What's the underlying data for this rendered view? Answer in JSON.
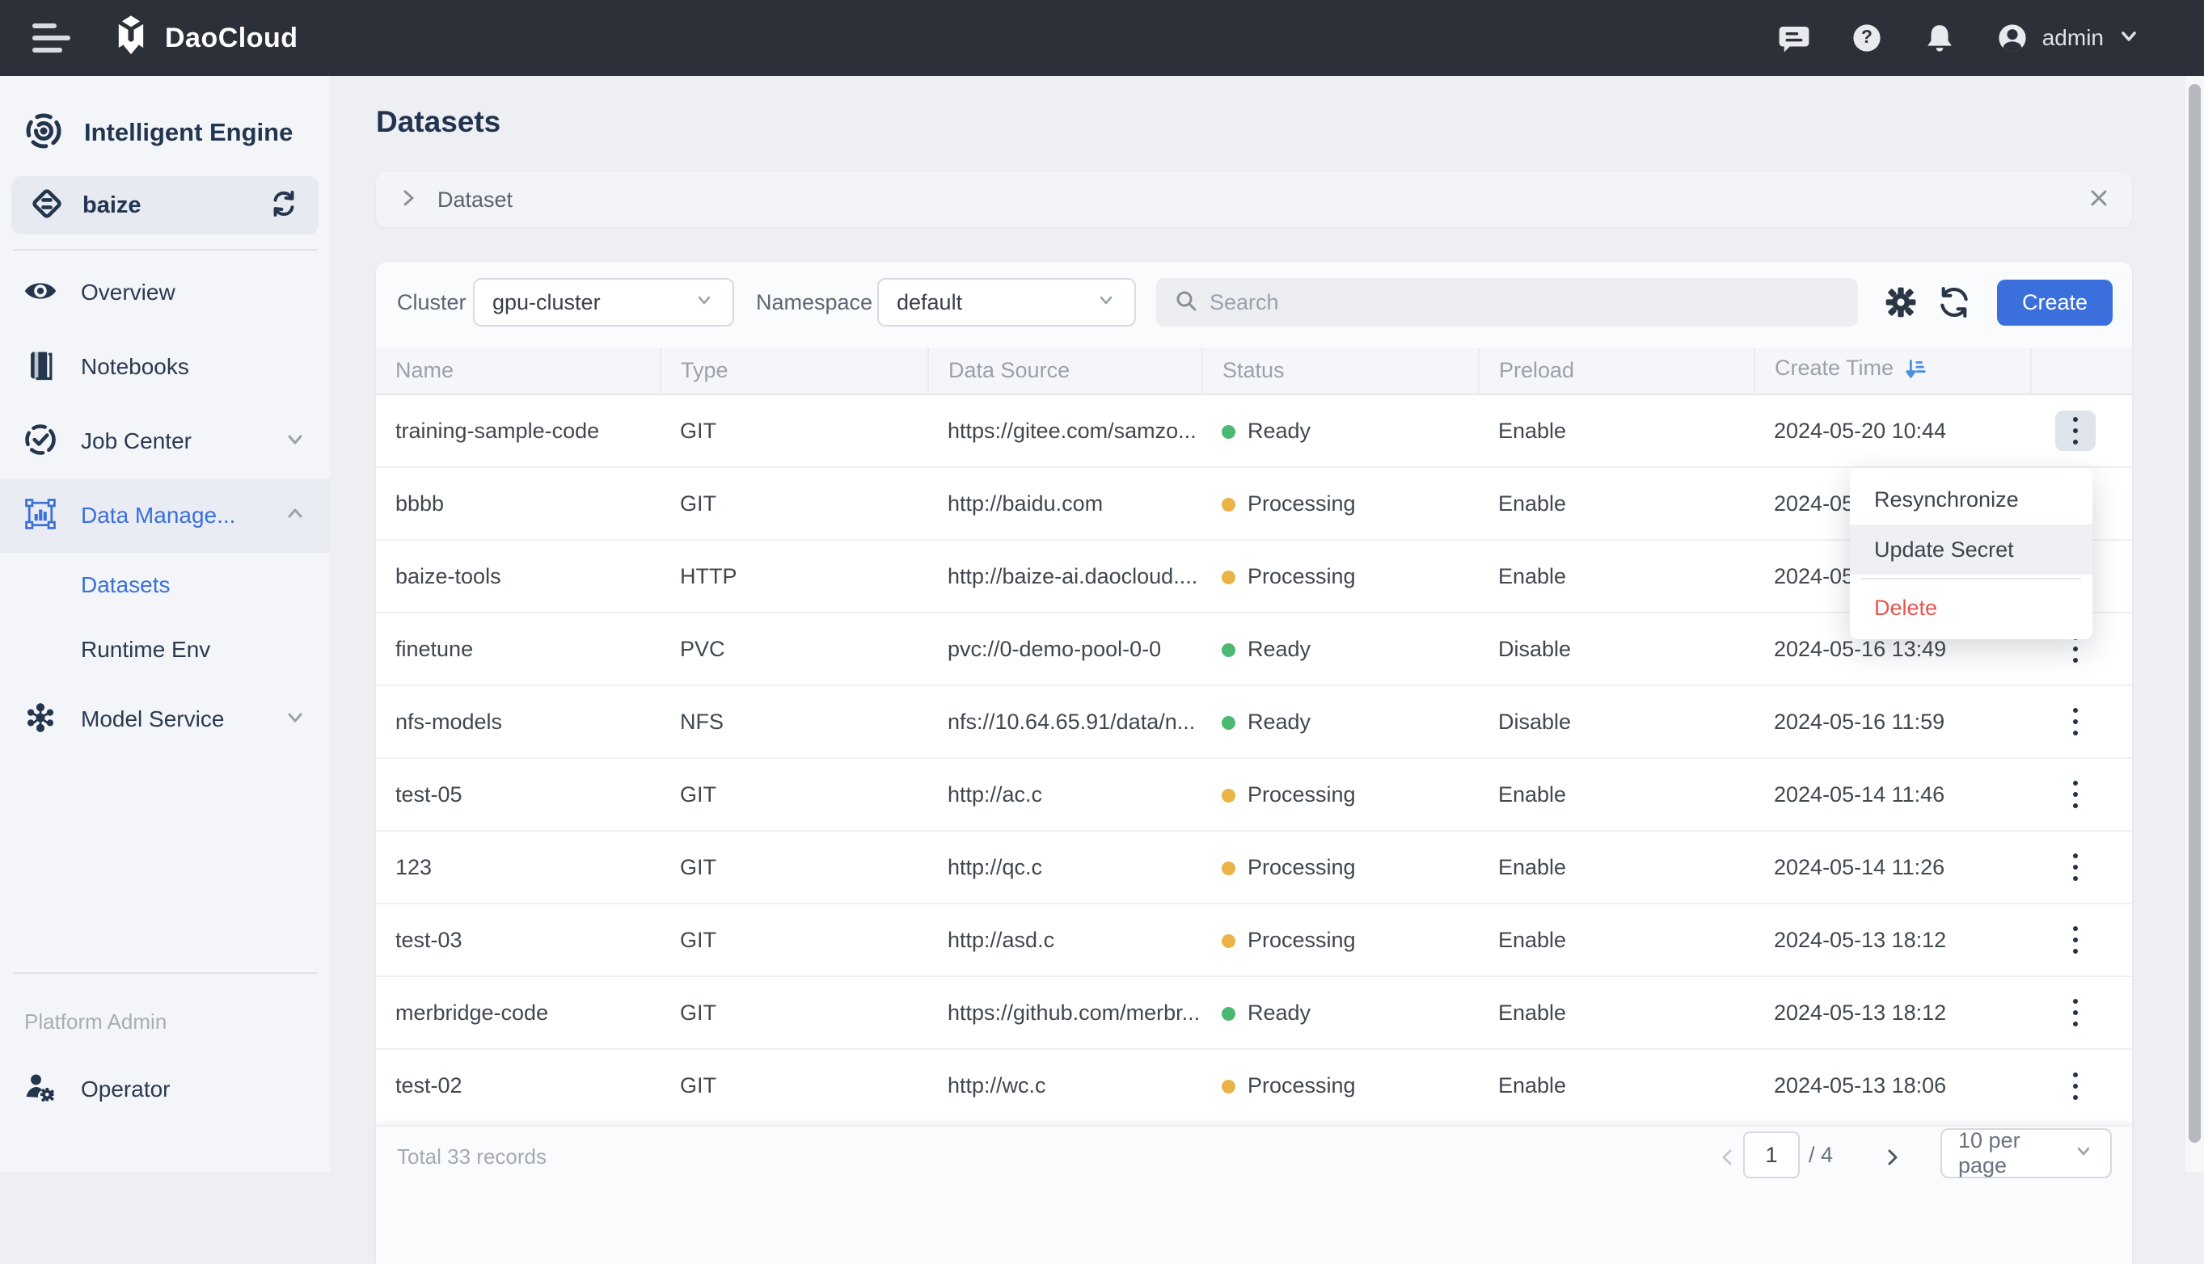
{
  "topbar": {
    "brand": "DaoCloud",
    "user": "admin"
  },
  "sidebar": {
    "product_label": "Intelligent Engine",
    "workspace_label": "baize",
    "items": [
      {
        "label": "Overview"
      },
      {
        "label": "Notebooks"
      },
      {
        "label": "Job Center"
      },
      {
        "label": "Data Manage..."
      },
      {
        "label": "Model Service"
      }
    ],
    "sub_items": [
      {
        "label": "Datasets"
      },
      {
        "label": "Runtime Env"
      }
    ],
    "section_label": "Platform Admin",
    "bottom_items": [
      {
        "label": "Operator"
      }
    ]
  },
  "page": {
    "title": "Datasets"
  },
  "expander": {
    "label": "Dataset"
  },
  "filters": {
    "cluster_label": "Cluster",
    "cluster_value": "gpu-cluster",
    "namespace_label": "Namespace",
    "namespace_value": "default",
    "search_placeholder": "Search",
    "create_label": "Create"
  },
  "table": {
    "columns": [
      "Name",
      "Type",
      "Data Source",
      "Status",
      "Preload",
      "Create Time"
    ],
    "rows": [
      {
        "name": "training-sample-code",
        "type": "GIT",
        "source": "https://gitee.com/samzo...",
        "status": "Ready",
        "status_color": "#4cb973",
        "preload": "Enable",
        "created": "2024-05-20 10:44"
      },
      {
        "name": "bbbb",
        "type": "GIT",
        "source": "http://baidu.com",
        "status": "Processing",
        "status_color": "#e9b445",
        "preload": "Enable",
        "created": "2024-05"
      },
      {
        "name": "baize-tools",
        "type": "HTTP",
        "source": "http://baize-ai.daocloud....",
        "status": "Processing",
        "status_color": "#e9b445",
        "preload": "Enable",
        "created": "2024-05"
      },
      {
        "name": "finetune",
        "type": "PVC",
        "source": "pvc://0-demo-pool-0-0",
        "status": "Ready",
        "status_color": "#4cb973",
        "preload": "Disable",
        "created": "2024-05-16 13:49"
      },
      {
        "name": "nfs-models",
        "type": "NFS",
        "source": "nfs://10.64.65.91/data/n...",
        "status": "Ready",
        "status_color": "#4cb973",
        "preload": "Disable",
        "created": "2024-05-16 11:59"
      },
      {
        "name": "test-05",
        "type": "GIT",
        "source": "http://ac.c",
        "status": "Processing",
        "status_color": "#e9b445",
        "preload": "Enable",
        "created": "2024-05-14 11:46"
      },
      {
        "name": "123",
        "type": "GIT",
        "source": "http://qc.c",
        "status": "Processing",
        "status_color": "#e9b445",
        "preload": "Enable",
        "created": "2024-05-14 11:26"
      },
      {
        "name": "test-03",
        "type": "GIT",
        "source": "http://asd.c",
        "status": "Processing",
        "status_color": "#e9b445",
        "preload": "Enable",
        "created": "2024-05-13 18:12"
      },
      {
        "name": "merbridge-code",
        "type": "GIT",
        "source": "https://github.com/merbr...",
        "status": "Ready",
        "status_color": "#4cb973",
        "preload": "Enable",
        "created": "2024-05-13 18:12"
      },
      {
        "name": "test-02",
        "type": "GIT",
        "source": "http://wc.c",
        "status": "Processing",
        "status_color": "#e9b445",
        "preload": "Enable",
        "created": "2024-05-13 18:06"
      }
    ]
  },
  "context_menu": {
    "items": [
      {
        "label": "Resynchronize"
      },
      {
        "label": "Update Secret"
      },
      {
        "label": "Delete"
      }
    ]
  },
  "pagination": {
    "total_text": "Total 33 records",
    "page": "1",
    "pages": "/ 4",
    "page_size": "10 per page"
  },
  "colors": {
    "primary": "#3b70dc",
    "status_ready": "#4cb973",
    "status_processing": "#e9b445",
    "danger": "#e4574f",
    "sort_icon": "#4a90e2"
  }
}
